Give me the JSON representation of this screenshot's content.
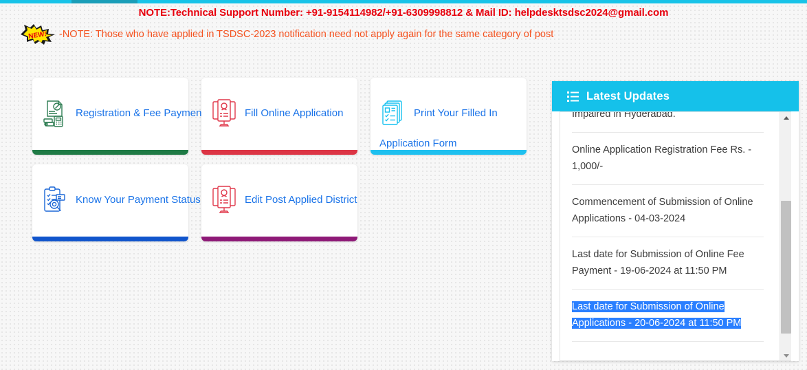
{
  "top_bar": {
    "accent_color": "#18c3e8",
    "tab_color": "#1a9eb8"
  },
  "notices": {
    "support_line": "NOTE:Technical Support Number: +91-9154114982/+91-6309998812 & Mail ID: helpdesktsdsc2024@gmail.com",
    "new_badge_label": "NEW!",
    "reapply_line": "-NOTE: Those who have applied in TSDSC-2023 notification need not apply again for the same category of post",
    "support_color": "#e8000d",
    "reapply_color": "#f4511e"
  },
  "cards": [
    {
      "label": "Registration & Fee Payment",
      "icon": "registration-fee-icon",
      "accent": "#1f7a45",
      "icon_color": "#2e7d52"
    },
    {
      "label": "Fill Online Application",
      "icon": "online-application-monitor-icon",
      "accent": "#dc3545",
      "icon_color": "#e0394b"
    },
    {
      "label": "Print Your Filled In Application Form",
      "icon": "print-documents-icon",
      "accent": "#1ec0ef",
      "icon_color": "#17c1f0"
    },
    {
      "label": "Know Your Payment Status",
      "icon": "payment-status-clipboard-icon",
      "accent": "#1155cc",
      "icon_color": "#1a66d6"
    },
    {
      "label": "Edit Post Applied District",
      "icon": "edit-district-monitor-icon",
      "accent": "#8e1a77",
      "icon_color": "#e0394b"
    }
  ],
  "updates": {
    "title": "Latest Updates",
    "header_icon": "list-icon",
    "header_color": "#15c1ea",
    "selection_color": "#2a7fff",
    "items": [
      {
        "text": "Schools for the Visually and Hearing Impaired in Hyderabad.",
        "selected": false
      },
      {
        "text": "Online Application Registration Fee Rs. - 1,000/-",
        "selected": false
      },
      {
        "text": "Commencement of Submission of Online Applications - 04-03-2024",
        "selected": false
      },
      {
        "text": "Last date for Submission of Online Fee Payment - 19-06-2024 at 11:50 PM",
        "selected": false
      },
      {
        "text": "Last date for Submission of Online Applications - 20-06-2024 at 11:50 PM",
        "selected": true
      }
    ]
  }
}
